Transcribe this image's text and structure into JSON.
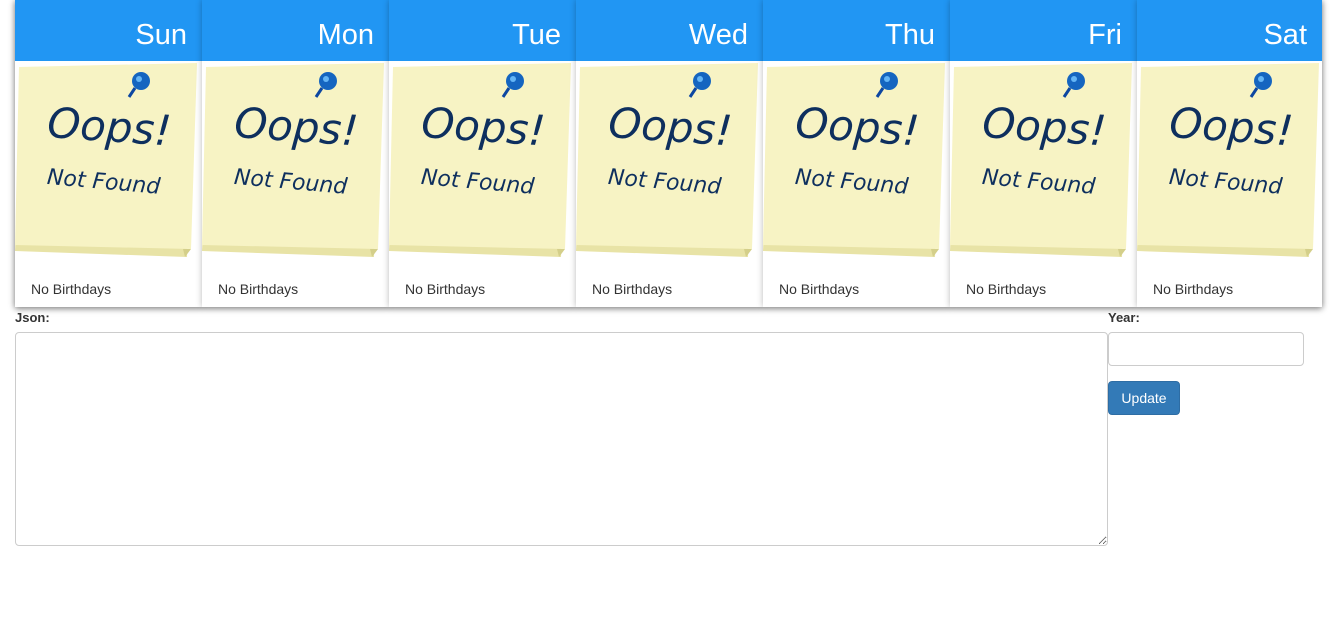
{
  "calendar": {
    "days": [
      {
        "label": "Sun",
        "footer": "No Birthdays"
      },
      {
        "label": "Mon",
        "footer": "No Birthdays"
      },
      {
        "label": "Tue",
        "footer": "No Birthdays"
      },
      {
        "label": "Wed",
        "footer": "No Birthdays"
      },
      {
        "label": "Thu",
        "footer": "No Birthdays"
      },
      {
        "label": "Fri",
        "footer": "No Birthdays"
      },
      {
        "label": "Sat",
        "footer": "No Birthdays"
      }
    ],
    "placeholder_note": {
      "headline": "Oops!",
      "subline": "Not Found"
    }
  },
  "form": {
    "json_label": "Json:",
    "json_value": "",
    "year_label": "Year:",
    "year_value": "",
    "update_label": "Update"
  },
  "colors": {
    "header_bg": "#2196f3",
    "note_yellow": "#f7f3c4",
    "note_text": "#0e2f5e",
    "pin_blue": "#1565c0",
    "button_bg": "#337ab7"
  },
  "icons": {
    "pin": "push-pin-icon",
    "note": "sticky-note-image"
  }
}
